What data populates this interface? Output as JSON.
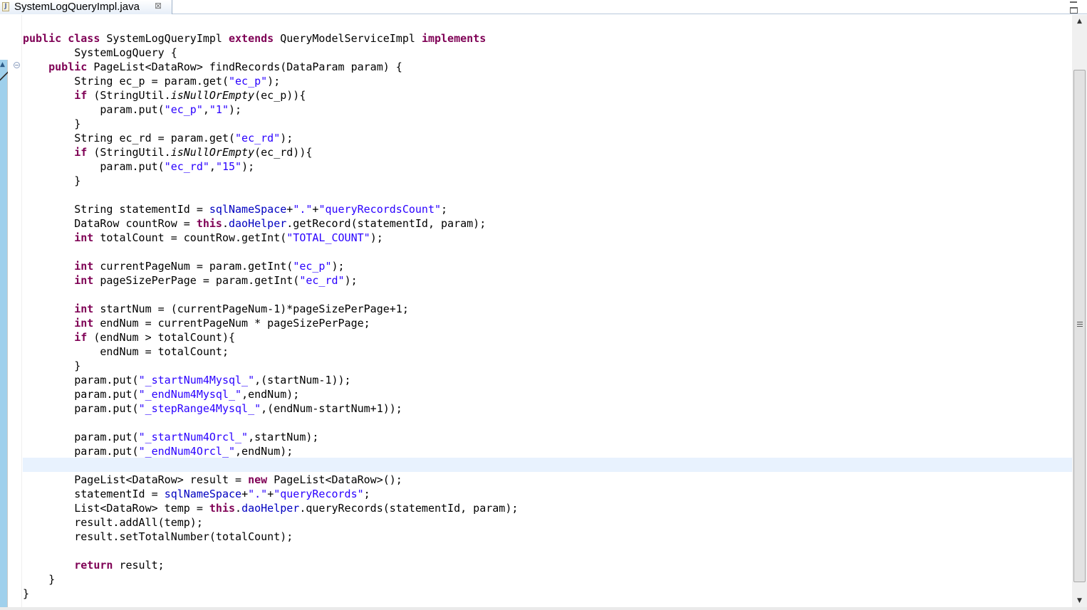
{
  "editor": {
    "tab_title": "SystemLogQueryImpl.java",
    "close_glyph": "⊠",
    "file_icon_glyph": "J",
    "fold_glyph": "−",
    "colors": {
      "keyword": "#7f0055",
      "string": "#2a00ff",
      "field": "#0000c0",
      "current_line": "#e8f2fe"
    }
  },
  "code": [
    [
      {
        "t": "public class ",
        "c": "kw"
      },
      {
        "t": "SystemLogQueryImpl "
      },
      {
        "t": "extends ",
        "c": "kw"
      },
      {
        "t": "QueryModelServiceImpl "
      },
      {
        "t": "implements",
        "c": "kw"
      }
    ],
    [
      {
        "t": "        SystemLogQuery {"
      }
    ],
    [
      {
        "t": "    "
      },
      {
        "t": "public ",
        "c": "kw"
      },
      {
        "t": "PageList<DataRow> findRecords(DataParam param) {"
      }
    ],
    [
      {
        "t": "        String ec_p = param.get("
      },
      {
        "t": "\"ec_p\"",
        "c": "str"
      },
      {
        "t": ");"
      }
    ],
    [
      {
        "t": "        "
      },
      {
        "t": "if ",
        "c": "kw"
      },
      {
        "t": "(StringUtil."
      },
      {
        "t": "isNullOrEmpty",
        "c": "it"
      },
      {
        "t": "(ec_p)){"
      }
    ],
    [
      {
        "t": "            param.put("
      },
      {
        "t": "\"ec_p\"",
        "c": "str"
      },
      {
        "t": ","
      },
      {
        "t": "\"1\"",
        "c": "str"
      },
      {
        "t": ");"
      }
    ],
    [
      {
        "t": "        }"
      }
    ],
    [
      {
        "t": "        String ec_rd = param.get("
      },
      {
        "t": "\"ec_rd\"",
        "c": "str"
      },
      {
        "t": ");"
      }
    ],
    [
      {
        "t": "        "
      },
      {
        "t": "if ",
        "c": "kw"
      },
      {
        "t": "(StringUtil."
      },
      {
        "t": "isNullOrEmpty",
        "c": "it"
      },
      {
        "t": "(ec_rd)){"
      }
    ],
    [
      {
        "t": "            param.put("
      },
      {
        "t": "\"ec_rd\"",
        "c": "str"
      },
      {
        "t": ","
      },
      {
        "t": "\"15\"",
        "c": "str"
      },
      {
        "t": ");"
      }
    ],
    [
      {
        "t": "        }"
      }
    ],
    [],
    [
      {
        "t": "        String statementId = "
      },
      {
        "t": "sqlNameSpace",
        "c": "fld"
      },
      {
        "t": "+"
      },
      {
        "t": "\".\"",
        "c": "str"
      },
      {
        "t": "+"
      },
      {
        "t": "\"queryRecordsCount\"",
        "c": "str"
      },
      {
        "t": ";"
      }
    ],
    [
      {
        "t": "        DataRow countRow = "
      },
      {
        "t": "this",
        "c": "kw"
      },
      {
        "t": "."
      },
      {
        "t": "daoHelper",
        "c": "fld"
      },
      {
        "t": ".getRecord(statementId, param);"
      }
    ],
    [
      {
        "t": "        "
      },
      {
        "t": "int ",
        "c": "kw"
      },
      {
        "t": "totalCount = countRow.getInt("
      },
      {
        "t": "\"TOTAL_COUNT\"",
        "c": "str"
      },
      {
        "t": ");"
      }
    ],
    [],
    [
      {
        "t": "        "
      },
      {
        "t": "int ",
        "c": "kw"
      },
      {
        "t": "currentPageNum = param.getInt("
      },
      {
        "t": "\"ec_p\"",
        "c": "str"
      },
      {
        "t": ");"
      }
    ],
    [
      {
        "t": "        "
      },
      {
        "t": "int ",
        "c": "kw"
      },
      {
        "t": "pageSizePerPage = param.getInt("
      },
      {
        "t": "\"ec_rd\"",
        "c": "str"
      },
      {
        "t": ");"
      }
    ],
    [],
    [
      {
        "t": "        "
      },
      {
        "t": "int ",
        "c": "kw"
      },
      {
        "t": "startNum = (currentPageNum-1)*pageSizePerPage+1;"
      }
    ],
    [
      {
        "t": "        "
      },
      {
        "t": "int ",
        "c": "kw"
      },
      {
        "t": "endNum = currentPageNum * pageSizePerPage;"
      }
    ],
    [
      {
        "t": "        "
      },
      {
        "t": "if ",
        "c": "kw"
      },
      {
        "t": "(endNum > totalCount){"
      }
    ],
    [
      {
        "t": "            endNum = totalCount;"
      }
    ],
    [
      {
        "t": "        }"
      }
    ],
    [
      {
        "t": "        param.put("
      },
      {
        "t": "\"_startNum4Mysql_\"",
        "c": "str"
      },
      {
        "t": ",(startNum-1));"
      }
    ],
    [
      {
        "t": "        param.put("
      },
      {
        "t": "\"_endNum4Mysql_\"",
        "c": "str"
      },
      {
        "t": ",endNum);"
      }
    ],
    [
      {
        "t": "        param.put("
      },
      {
        "t": "\"_stepRange4Mysql_\"",
        "c": "str"
      },
      {
        "t": ",(endNum-startNum+1));"
      }
    ],
    [],
    [
      {
        "t": "        param.put("
      },
      {
        "t": "\"_startNum4Orcl_\"",
        "c": "str"
      },
      {
        "t": ",startNum);"
      }
    ],
    [
      {
        "t": "        param.put("
      },
      {
        "t": "\"_endNum4Orcl_\"",
        "c": "str"
      },
      {
        "t": ",endNum);"
      }
    ],
    [],
    [
      {
        "t": "        PageList<DataRow> result = "
      },
      {
        "t": "new ",
        "c": "kw"
      },
      {
        "t": "PageList<DataRow>();"
      }
    ],
    [
      {
        "t": "        statementId = "
      },
      {
        "t": "sqlNameSpace",
        "c": "fld"
      },
      {
        "t": "+"
      },
      {
        "t": "\".\"",
        "c": "str"
      },
      {
        "t": "+"
      },
      {
        "t": "\"queryRecords\"",
        "c": "str"
      },
      {
        "t": ";"
      }
    ],
    [
      {
        "t": "        List<DataRow> temp = "
      },
      {
        "t": "this",
        "c": "kw"
      },
      {
        "t": "."
      },
      {
        "t": "daoHelper",
        "c": "fld"
      },
      {
        "t": ".queryRecords(statementId, param);"
      }
    ],
    [
      {
        "t": "        result.addAll(temp);"
      }
    ],
    [
      {
        "t": "        result.setTotalNumber(totalCount);"
      }
    ],
    [],
    [
      {
        "t": "        "
      },
      {
        "t": "return ",
        "c": "kw"
      },
      {
        "t": "result;"
      }
    ],
    [
      {
        "t": "    }"
      }
    ],
    [
      {
        "t": "}"
      }
    ]
  ]
}
